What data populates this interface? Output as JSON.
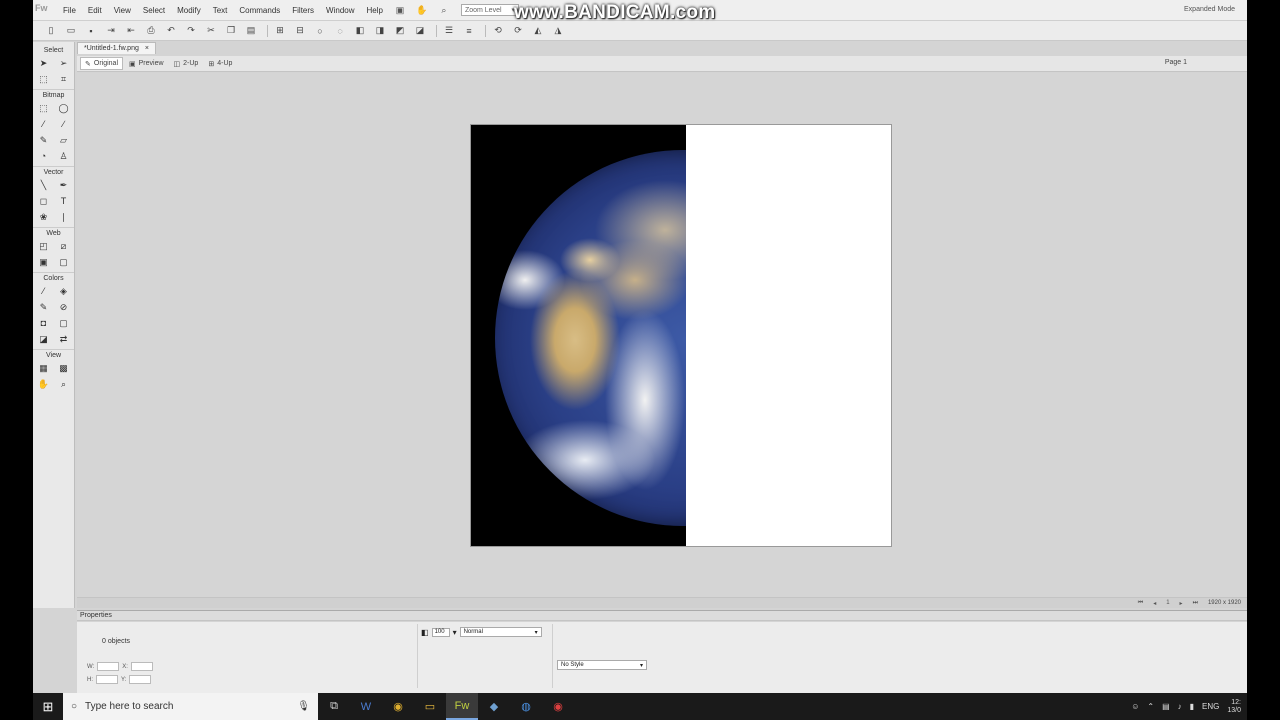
{
  "watermark": "www.BANDICAM.com",
  "menubar": {
    "logo": "Fw",
    "items": [
      "File",
      "Edit",
      "View",
      "Select",
      "Modify",
      "Text",
      "Commands",
      "Filters",
      "Window",
      "Help"
    ],
    "zoom_level": "Zoom Level",
    "expanded_mode": "Expanded Mode"
  },
  "document": {
    "tab_label": "*Untitled-1.fw.png",
    "close_glyph": "×",
    "views": [
      "Original",
      "Preview",
      "2-Up",
      "4-Up"
    ],
    "page_label": "Page 1"
  },
  "tools": {
    "sections": [
      "Select",
      "Bitmap",
      "Vector",
      "Web",
      "Colors",
      "View"
    ]
  },
  "status": {
    "page_number": "1",
    "doc_size": "1920 x 1920"
  },
  "properties": {
    "header": "Properties",
    "object_count": "0 objects",
    "w_label": "W:",
    "h_label": "H:",
    "x_label": "X:",
    "y_label": "Y:",
    "opacity": "100",
    "blend_mode": "Normal",
    "style": "No Style"
  },
  "taskbar": {
    "search_placeholder": "Type here to search",
    "language": "ENG",
    "time": "12:",
    "date": "13/0"
  }
}
